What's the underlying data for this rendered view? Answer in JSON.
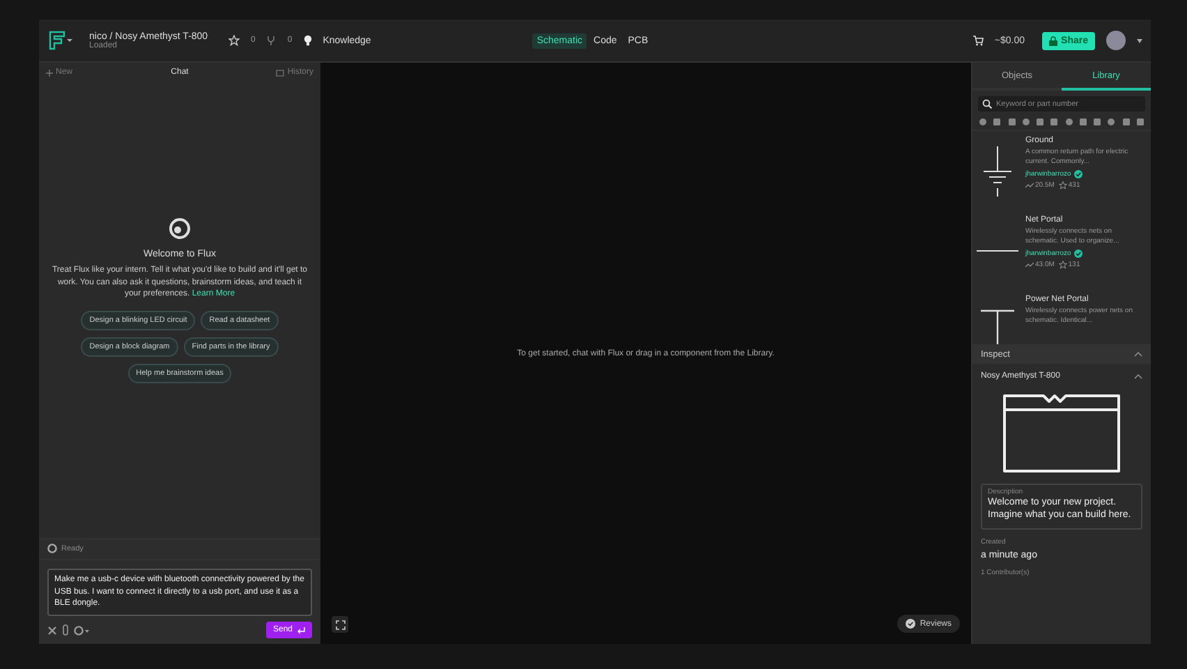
{
  "topbar": {
    "breadcrumb": "nico / Nosy Amethyst T-800",
    "status": "Loaded",
    "star_count": "0",
    "fork_count": "0",
    "knowledge": "Knowledge",
    "view_tabs": [
      {
        "label": "Schematic",
        "selected": true
      },
      {
        "label": "Code",
        "selected": false
      },
      {
        "label": "PCB",
        "selected": false
      }
    ],
    "price": "~$0.00",
    "share": "Share"
  },
  "chat": {
    "new": "New",
    "title": "Chat",
    "history": "History",
    "welcome_title": "Welcome to Flux",
    "welcome_text": "Treat Flux like your intern. Tell it what you'd like to build and it'll get to work. You can also ask it questions, brainstorm ideas, and teach it your preferences.",
    "learn_more": "Learn More",
    "suggestions": [
      "Design a blinking LED circuit",
      "Read a datasheet",
      "Design a block diagram",
      "Find parts in the library",
      "Help me brainstorm ideas"
    ],
    "status": "Ready",
    "message": "Make me a usb-c device with bluetooth connectivity powered by the USB bus. I want to connect it directly to a usb port, and use it as a BLE dongle.",
    "send": "Send"
  },
  "canvas": {
    "hint": "To get started, chat with Flux or drag in a component from the Library.",
    "reviews": "Reviews"
  },
  "sidebar": {
    "tabs": [
      {
        "label": "Objects",
        "selected": false
      },
      {
        "label": "Library",
        "selected": true
      }
    ],
    "search_placeholder": "Keyword or part number",
    "parts": [
      {
        "kind": "ground",
        "name": "Ground",
        "description": "A common return path for electric current. Commonly...",
        "author": "jharwinbarrozo",
        "uses": "20.5M",
        "stars": "431"
      },
      {
        "kind": "net",
        "name": "Net Portal",
        "description": "Wirelessly connects nets on schematic. Used to organize...",
        "author": "jharwinbarrozo",
        "uses": "43.0M",
        "stars": "131"
      },
      {
        "kind": "power",
        "name": "Power Net Portal",
        "description": "Wirelessly connects power nets on schematic. Identical..."
      }
    ],
    "inspect": "Inspect",
    "project_name": "Nosy Amethyst T-800",
    "description_label": "Description",
    "description": "Welcome to your new project. Imagine what you can build here.",
    "created_label": "Created",
    "created": "a minute ago",
    "contributors": "1 Contributor(s)"
  }
}
